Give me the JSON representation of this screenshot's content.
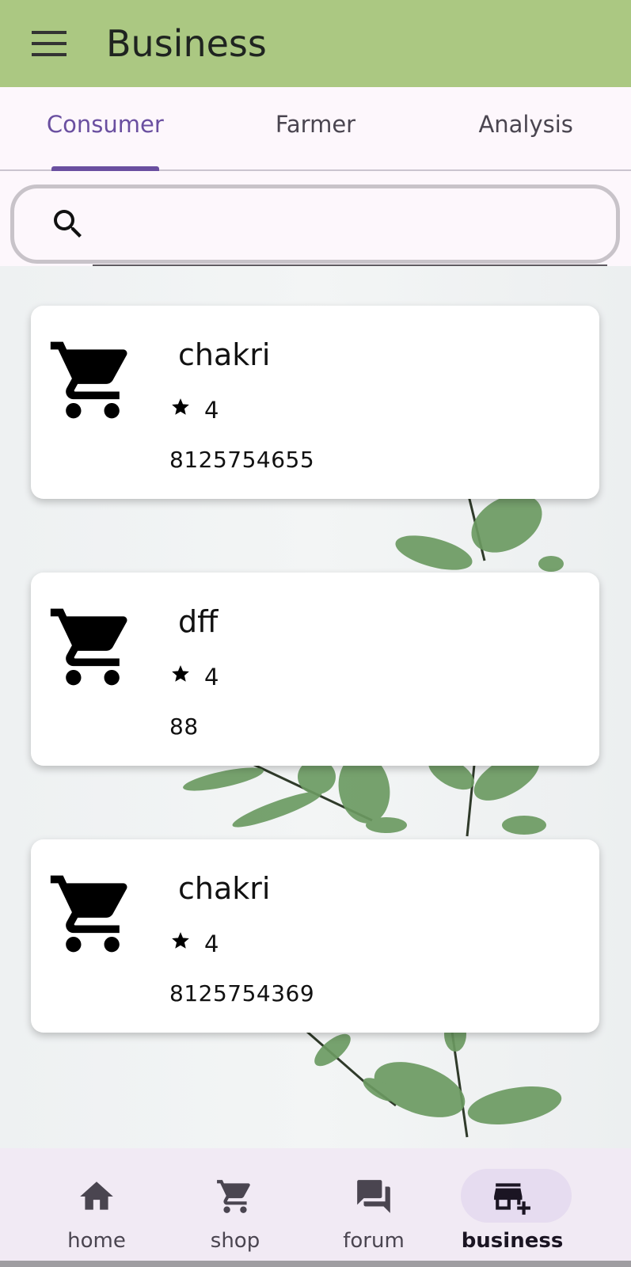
{
  "appbar": {
    "title": "Business",
    "menu_icon": "menu-icon"
  },
  "tabs": [
    {
      "label": "Consumer",
      "active": true
    },
    {
      "label": "Farmer",
      "active": false
    },
    {
      "label": "Analysis",
      "active": false
    }
  ],
  "search": {
    "value": "",
    "placeholder": "",
    "icon": "search-icon"
  },
  "cards": [
    {
      "name": "chakri",
      "rating": "4",
      "phone": "8125754655",
      "icon": "cart-icon"
    },
    {
      "name": "dff",
      "rating": "4",
      "phone": "88",
      "icon": "cart-icon"
    },
    {
      "name": "chakri",
      "rating": "4",
      "phone": "8125754369",
      "icon": "cart-icon"
    }
  ],
  "bottom_nav": [
    {
      "label": "home",
      "icon": "home-icon",
      "active": false
    },
    {
      "label": "shop",
      "icon": "cart-icon",
      "active": false
    },
    {
      "label": "forum",
      "icon": "forum-icon",
      "active": false
    },
    {
      "label": "business",
      "icon": "add-business-icon",
      "active": true
    }
  ],
  "colors": {
    "appbar": "#abc882",
    "accent": "#6a4fa0",
    "surface": "#fdf7fc",
    "nav_background": "#f1eaf4"
  }
}
